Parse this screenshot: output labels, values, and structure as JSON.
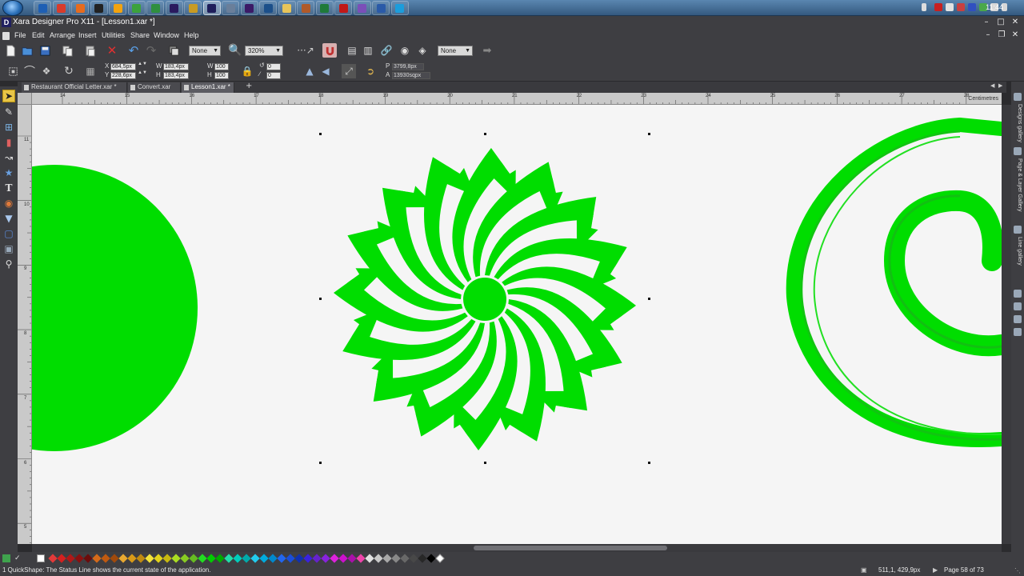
{
  "taskbar": {
    "clock": "11:44",
    "apps": [
      {
        "name": "ie-icon",
        "color": "#1e5fb4"
      },
      {
        "name": "chrome-icon",
        "color": "#d93b2b"
      },
      {
        "name": "firefox-icon",
        "color": "#e66b1e"
      },
      {
        "name": "calculator-icon",
        "color": "#222222"
      },
      {
        "name": "media-icon",
        "color": "#f2a30f"
      },
      {
        "name": "xbox-icon",
        "color": "#3ca23c"
      },
      {
        "name": "globe-icon",
        "color": "#2f8f3f"
      },
      {
        "name": "after-effects-icon",
        "color": "#2a1a5e"
      },
      {
        "name": "bridge-icon",
        "color": "#c89b23"
      },
      {
        "name": "xara-designer-icon",
        "color": "#1e1e5a"
      },
      {
        "name": "monitor-icon",
        "color": "#6a7f9a"
      },
      {
        "name": "premiere-icon",
        "color": "#3b1a66"
      },
      {
        "name": "photoshop-icon",
        "color": "#1b4f8a"
      },
      {
        "name": "folder-icon",
        "color": "#e7c45a"
      },
      {
        "name": "tool-icon",
        "color": "#b05a2a"
      },
      {
        "name": "excel-icon",
        "color": "#1f7a3a"
      },
      {
        "name": "acrobat-icon",
        "color": "#c01818"
      },
      {
        "name": "viber-icon",
        "color": "#7b4fb8"
      },
      {
        "name": "word-icon",
        "color": "#2a5aa8"
      },
      {
        "name": "skype-icon",
        "color": "#1b9ddc"
      }
    ]
  },
  "window": {
    "title": "Xara Designer Pro X11 - [Lesson1.xar *]",
    "logo": "D"
  },
  "menu": [
    "File",
    "Edit",
    "Arrange",
    "Insert",
    "Utilities",
    "Share",
    "Window",
    "Help"
  ],
  "toolbar1": {
    "blend_mode": "None",
    "zoom": "320%",
    "feather": "None"
  },
  "toolbar2": {
    "x_label": "X",
    "x_value": "684,5px",
    "y_label": "Y",
    "y_value": "228,6px",
    "w_label": "W",
    "w_value": "183,4px",
    "h_label": "H",
    "h_value": "183,4px",
    "w_pct": "100",
    "h_pct": "100",
    "rotation": "0",
    "skew": "0",
    "p_label": "P",
    "p_value": "3799,8px",
    "a_label": "A",
    "a_value": "13930sqpx"
  },
  "doc_tabs": [
    {
      "label": "Restaurant Official Letter.xar *",
      "active": false
    },
    {
      "label": "Convert.xar",
      "active": false
    },
    {
      "label": "Lesson1.xar *",
      "active": true
    }
  ],
  "ruler": {
    "units": "Centimetres",
    "top_labels": [
      "14",
      "15",
      "16",
      "17",
      "18",
      "19",
      "20",
      "21",
      "22",
      "23",
      "24",
      "25",
      "26",
      "27",
      "28"
    ],
    "left_labels": [
      "11",
      "10",
      "9",
      "8",
      "7",
      "6",
      "5"
    ]
  },
  "canvas": {
    "shape_color": "#00dd00"
  },
  "galleries": [
    "Designs gallery",
    "Page & Layer Gallery",
    "Line gallery"
  ],
  "palette": [
    "#e23a3a",
    "#d42020",
    "#b01818",
    "#8a1010",
    "#6a0c0c",
    "#d46a1a",
    "#c05a10",
    "#a04a0c",
    "#e8a830",
    "#d89a18",
    "#c08a10",
    "#f2e23a",
    "#e2d21a",
    "#c8b810",
    "#aadd22",
    "#88cc22",
    "#66bb22",
    "#22dd22",
    "#00cc00",
    "#00aa00",
    "#22ddaa",
    "#00ccbb",
    "#00aaaa",
    "#22ccee",
    "#00aadd",
    "#0088cc",
    "#2266ee",
    "#1a4ed8",
    "#1030b0",
    "#3a22dd",
    "#6622cc",
    "#8822dd",
    "#dd22dd",
    "#cc11cc",
    "#aa10aa",
    "#ee44aa",
    "#e0e0e0",
    "#c8c8c8",
    "#a8a8a8",
    "#888888",
    "#686868",
    "#484848",
    "#282828",
    "#000000",
    "#ffffff"
  ],
  "status": {
    "text": "1 QuickShape: The Status Line shows the current state of the application.",
    "coords": "511,1, 429,9px",
    "page": "Page 58 of 73"
  }
}
